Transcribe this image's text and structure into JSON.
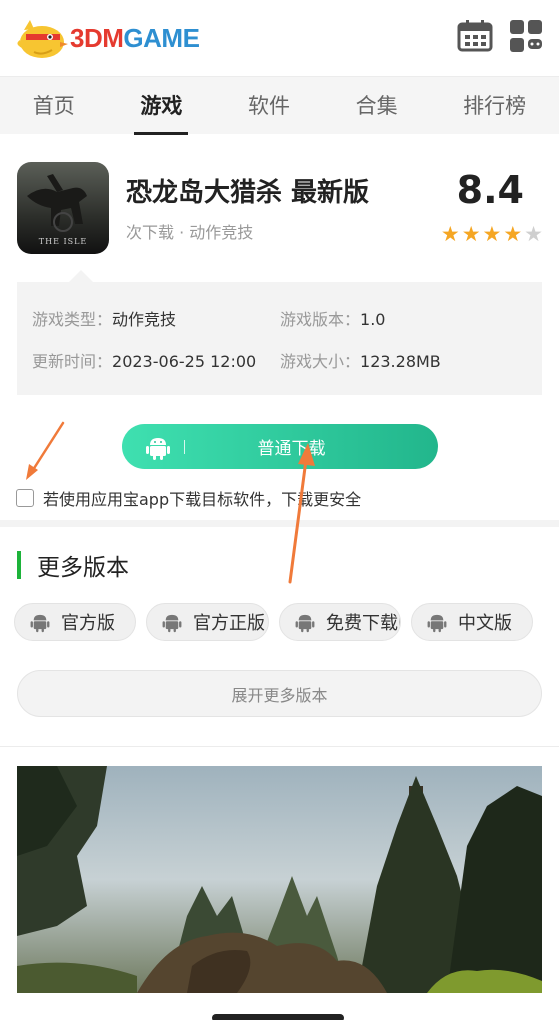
{
  "brand": {
    "logo_prefix": "3DM",
    "logo_suffix": "GAME"
  },
  "header": {
    "icons": [
      "calendar-icon",
      "apps-grid-icon"
    ]
  },
  "nav": {
    "items": [
      "首页",
      "游戏",
      "软件",
      "合集",
      "排行榜"
    ],
    "active_index": 1
  },
  "game": {
    "title": "恐龙岛大猎杀 最新版",
    "subtitle": "次下载 · 动作竞技",
    "score": "8.4",
    "stars_filled": 4,
    "stars_total": 5,
    "icon_text": "THE ISLE"
  },
  "info": {
    "type_label": "游戏类型：",
    "type_value": "动作竞技",
    "version_label": "游戏版本：",
    "version_value": "1.0",
    "update_label": "更新时间：",
    "update_value": "2023-06-25 12:00",
    "size_label": "游戏大小：",
    "size_value": "123.28MB"
  },
  "download": {
    "label": "普通下载",
    "safe_text": "若使用应用宝app下载目标软件，下载更安全",
    "safe_checked": false
  },
  "versions": {
    "title": "更多版本",
    "chips": [
      "官方版",
      "官方正版",
      "免费下载中",
      "中文版"
    ],
    "expand_label": "展开更多版本"
  },
  "colors": {
    "accent_green": "#22b68c",
    "section_bar": "#1db33a",
    "star": "#f5a623",
    "arrow": "#f07a3a"
  }
}
